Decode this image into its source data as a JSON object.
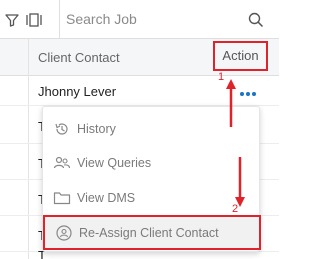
{
  "toolbar": {
    "search_placeholder": "Search Job",
    "icons": [
      "filter-icon",
      "column-toggle-icon",
      "search-icon"
    ]
  },
  "table": {
    "headers": {
      "client_contact": "Client Contact",
      "action": "Action"
    },
    "rows": [
      {
        "client_contact": "Jhonny Lever"
      },
      {
        "client_contact": "T"
      },
      {
        "client_contact": "T"
      },
      {
        "client_contact": "T"
      },
      {
        "client_contact": "T"
      },
      {
        "client_contact": "T"
      }
    ]
  },
  "action_menu": {
    "items": [
      {
        "label": "History",
        "icon": "history-icon"
      },
      {
        "label": "View Queries",
        "icon": "users-icon"
      },
      {
        "label": "View DMS",
        "icon": "folder-icon"
      },
      {
        "label": "Re-Assign Client Contact",
        "icon": "reassign-contact-icon"
      }
    ]
  },
  "annotations": {
    "step1": "1",
    "step2": "2",
    "color": "#e0222a"
  },
  "colors": {
    "accent": "#1a73c8",
    "highlight": "#e0222a"
  }
}
